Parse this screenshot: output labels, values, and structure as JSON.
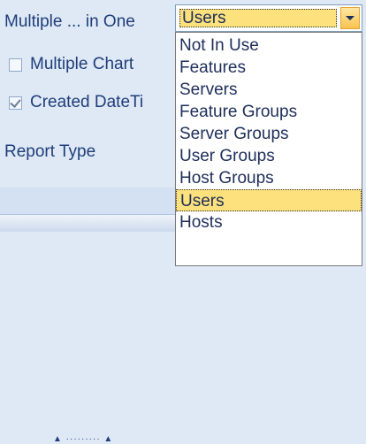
{
  "form": {
    "multiple_label": "Multiple ... in One",
    "multiple_chart": {
      "label": "Multiple Chart",
      "checked": false
    },
    "created_datetime": {
      "label": "Created DateTi",
      "checked": true
    },
    "report_type_label": "Report Type",
    "splitter_glyphs": "▲ ········· ▲"
  },
  "combo": {
    "selected_value": "Users",
    "options": [
      "Not In Use",
      "Features",
      "Servers",
      "Feature Groups",
      "Server Groups",
      "User Groups",
      "Host Groups",
      "Users",
      "Hosts"
    ],
    "highlighted_index": 7,
    "highlight_color": "#fce17c"
  }
}
